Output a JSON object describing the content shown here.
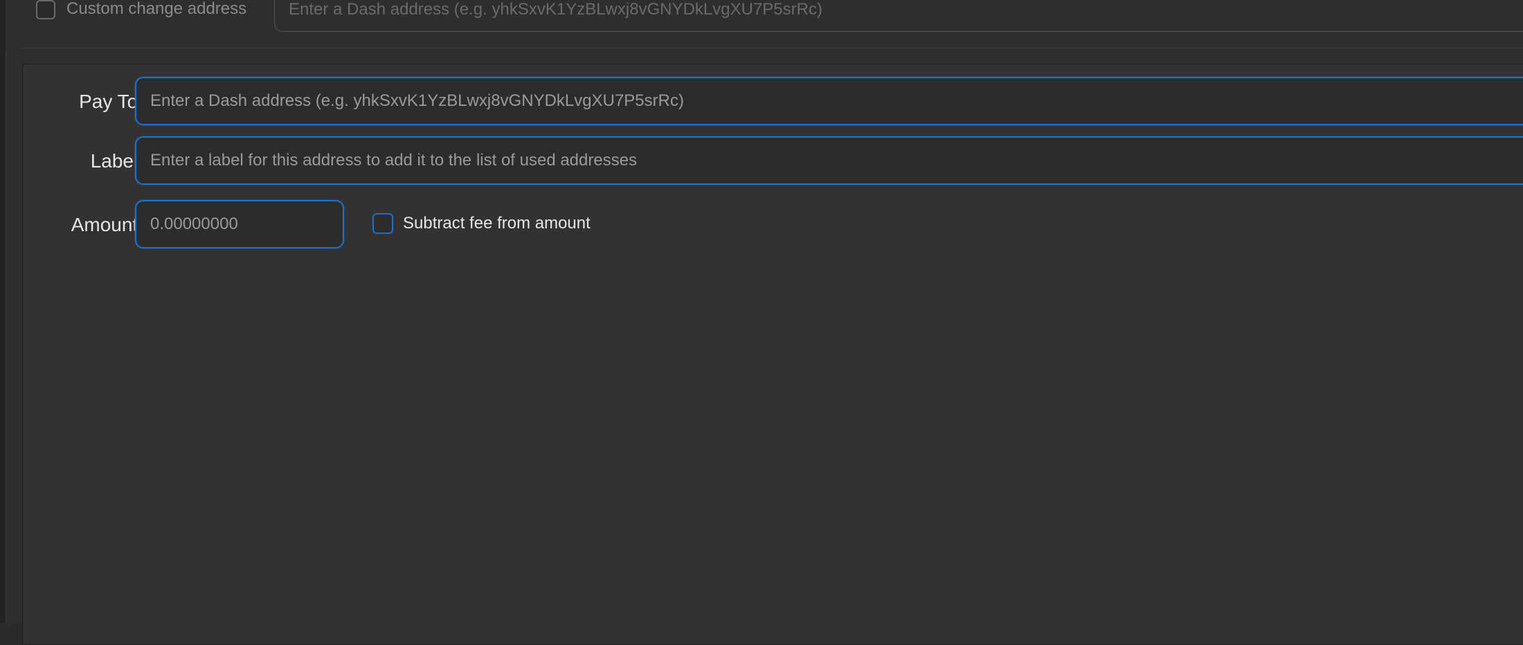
{
  "change_address": {
    "checkbox_label": "Custom change address",
    "checked": false,
    "input_placeholder": "Enter a Dash address (e.g. yhkSxvK1YzBLwxj8vGNYDkLvgXU7P5srRc)"
  },
  "recipient": {
    "pay_to": {
      "label": "Pay To:",
      "placeholder": "Enter a Dash address (e.g. yhkSxvK1YzBLwxj8vGNYDkLvgXU7P5srRc)",
      "value": ""
    },
    "label_field": {
      "label": "Label:",
      "placeholder": "Enter a label for this address to add it to the list of used addresses",
      "value": ""
    },
    "amount": {
      "label": "Amount:",
      "placeholder": "0.00000000",
      "value": ""
    },
    "subtract_fee": {
      "label": "Subtract fee from amount",
      "checked": false
    }
  },
  "colors": {
    "background": "#2e2e2e",
    "panel": "#323232",
    "focus_accent": "#1f6fd1",
    "text": "#e6e6e6",
    "placeholder": "#9a9a9a"
  }
}
